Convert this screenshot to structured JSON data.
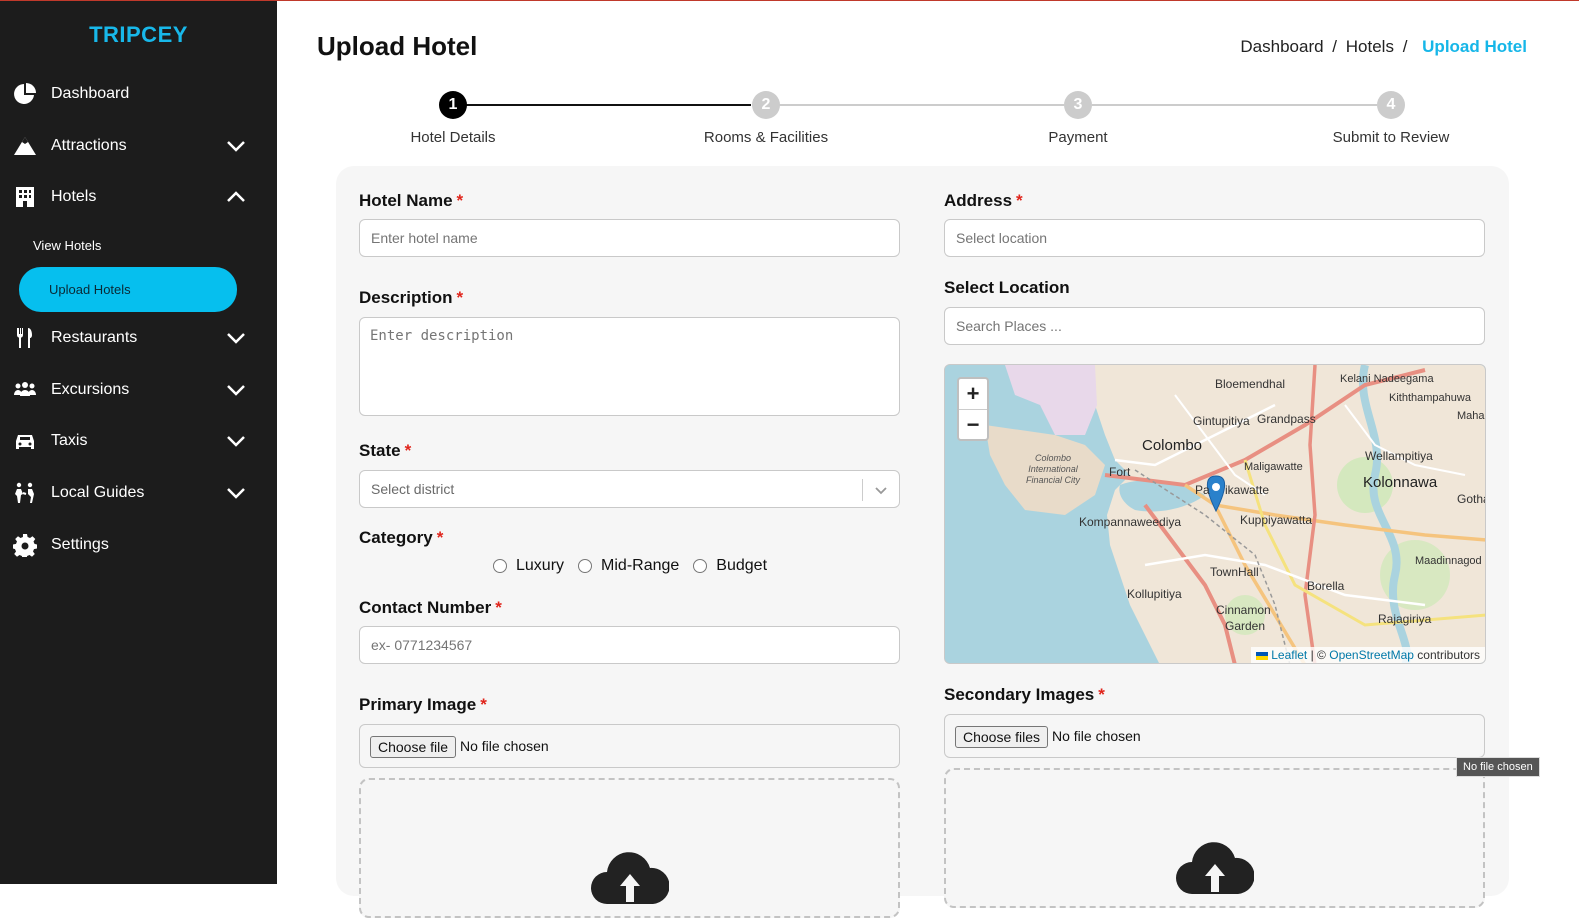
{
  "brand": "TRIPCEY",
  "sidebar": {
    "items": [
      {
        "label": "Dashboard"
      },
      {
        "label": "Attractions"
      },
      {
        "label": "Hotels"
      },
      {
        "label": "Restaurants"
      },
      {
        "label": "Excursions"
      },
      {
        "label": "Taxis"
      },
      {
        "label": "Local Guides"
      },
      {
        "label": "Settings"
      }
    ],
    "sub_items": [
      {
        "label": "View Hotels"
      },
      {
        "label": "Upload Hotels"
      }
    ]
  },
  "page": {
    "title": "Upload Hotel",
    "breadcrumb": {
      "dashboard": "Dashboard",
      "sep1": "/",
      "hotels": "Hotels",
      "sep2": "/",
      "current": "Upload Hotel"
    }
  },
  "stepper": {
    "steps": [
      {
        "num": "1",
        "label": "Hotel Details"
      },
      {
        "num": "2",
        "label": "Rooms & Facilities"
      },
      {
        "num": "3",
        "label": "Payment"
      },
      {
        "num": "4",
        "label": "Submit to Review"
      }
    ]
  },
  "form": {
    "required_mark": "*",
    "hotel_name": {
      "label": "Hotel Name",
      "placeholder": "Enter hotel name"
    },
    "description": {
      "label": "Description",
      "placeholder": "Enter description"
    },
    "state": {
      "label": "State",
      "placeholder": "Select district"
    },
    "category": {
      "label": "Category",
      "options": [
        "Luxury",
        "Mid-Range",
        "Budget"
      ]
    },
    "contact": {
      "label": "Contact Number",
      "placeholder": "ex- 0771234567"
    },
    "primary_image": {
      "label": "Primary Image",
      "button": "Choose file",
      "status": "No file chosen"
    },
    "address": {
      "label": "Address",
      "placeholder": "Select location"
    },
    "select_location": {
      "label": "Select Location",
      "placeholder": "Search Places ..."
    },
    "secondary_images": {
      "label": "Secondary Images",
      "button": "Choose files",
      "status": "No file chosen",
      "tooltip": "No file chosen"
    }
  },
  "map": {
    "zoom_in": "+",
    "zoom_out": "−",
    "attribution": {
      "leaflet": "Leaflet",
      "sep": "| ©",
      "osm": "OpenStreetMap",
      "suffix": "contributors"
    },
    "labels": {
      "bloemendhal": "Bloemendhal",
      "kelani": "Kelani Nadeegama",
      "kiththampahuwa": "Kiththampahuwa",
      "maha": "Maha",
      "gintupitiya": "Gintupitiya",
      "grandpass": "Grandpass",
      "colombo": "Colombo",
      "wellampitiya": "Wellampitiya",
      "maligawatte": "Maligawatte",
      "fort": "Fort",
      "kolonnawa": "Kolonnawa",
      "gothatu": "Gothatu",
      "pamankada": "Pa",
      "likawatte": "ikawatte",
      "kompannaweediya": "Kompannaweediya",
      "kuppiyawatta": "Kuppiyawatta",
      "cic": "Colombo International Financial City",
      "maadinnagod": "Maadinnagod",
      "townhall": "TownHall",
      "borella": "Borella",
      "kollupitiya": "Kollupitiya",
      "cinnamon": "Cinnamon",
      "garden": "Garden",
      "rajagiriya": "Rajagiriya"
    }
  },
  "colors": {
    "brand": "#18b8ea",
    "sidebar_bg": "#1c1c1c",
    "active_item": "#06bfee",
    "breadcrumb_active": "#16b6e8",
    "required": "#e0241b",
    "step_active": "#000000",
    "step_inactive": "#cccccc"
  }
}
